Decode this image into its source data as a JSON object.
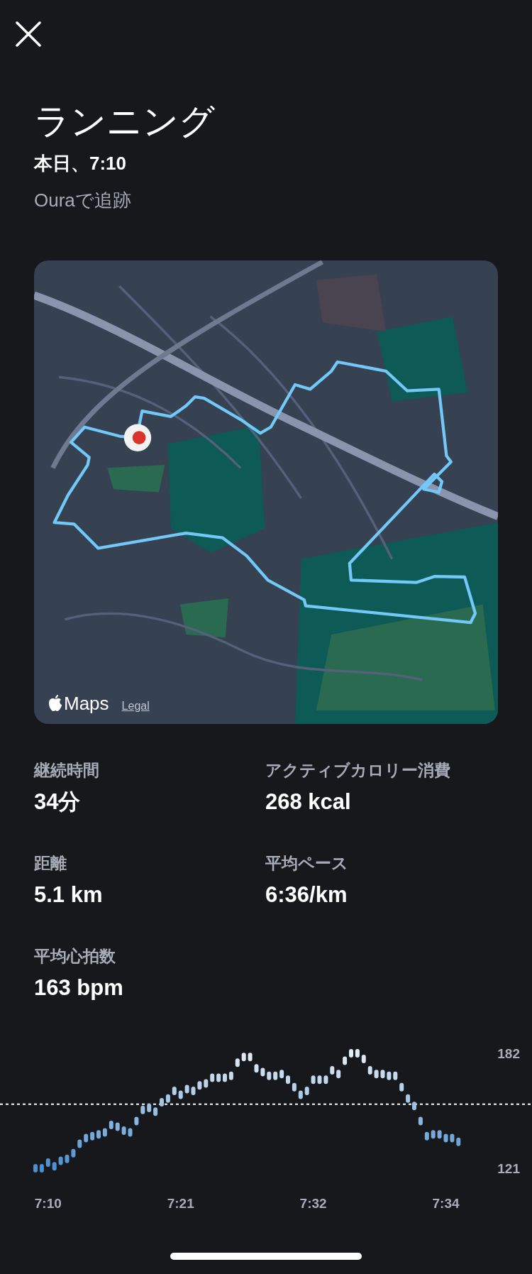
{
  "header": {
    "title": "ランニング",
    "date": "本日、7:10",
    "source": "Ouraで追跡"
  },
  "map": {
    "kind": "picture",
    "brand": "Maps",
    "legal": "Legal"
  },
  "stats": [
    {
      "label": "継続時間",
      "value": "34分"
    },
    {
      "label": "アクティブカロリー消費",
      "value": "268 kcal"
    },
    {
      "label": "距離",
      "value": "5.1 km"
    },
    {
      "label": "平均ペース",
      "value": "6:36/km"
    },
    {
      "label": "平均心拍数",
      "value": "163 bpm"
    }
  ],
  "heart_rate": {
    "chart_data": {
      "type": "scatter",
      "ylim": [
        121,
        182
      ],
      "yticks": [
        121,
        182
      ],
      "ref_lines": [
        {
          "axis": "y",
          "value": 155
        }
      ],
      "categories": [
        null,
        null,
        "7:10",
        null,
        null,
        null,
        null,
        null,
        null,
        null,
        null,
        null,
        null,
        null,
        null,
        null,
        null,
        null,
        null,
        null,
        null,
        null,
        null,
        "7:21",
        null,
        null,
        null,
        null,
        null,
        null,
        null,
        null,
        null,
        null,
        null,
        null,
        null,
        null,
        null,
        null,
        null,
        null,
        null,
        null,
        "7:32",
        null,
        null,
        null,
        null,
        null,
        null,
        null,
        null,
        null,
        null,
        null,
        null,
        null,
        null,
        null,
        null,
        null,
        null,
        null,
        null,
        "7:34",
        null,
        null
      ],
      "series": [
        {
          "values": [
            121,
            121,
            124,
            122,
            125,
            126,
            129,
            134,
            137,
            138,
            139,
            140,
            144,
            143,
            141,
            140,
            146,
            152,
            153,
            151,
            156,
            158,
            162,
            160,
            163,
            162,
            165,
            166,
            169,
            169,
            169,
            170,
            177,
            180,
            180,
            174,
            172,
            170,
            170,
            171,
            168,
            164,
            160,
            162,
            168,
            168,
            168,
            173,
            171,
            178,
            182,
            182,
            179,
            173,
            171,
            171,
            170,
            170,
            164,
            158,
            154,
            146,
            138,
            139,
            139,
            137,
            137,
            135
          ]
        }
      ]
    }
  }
}
